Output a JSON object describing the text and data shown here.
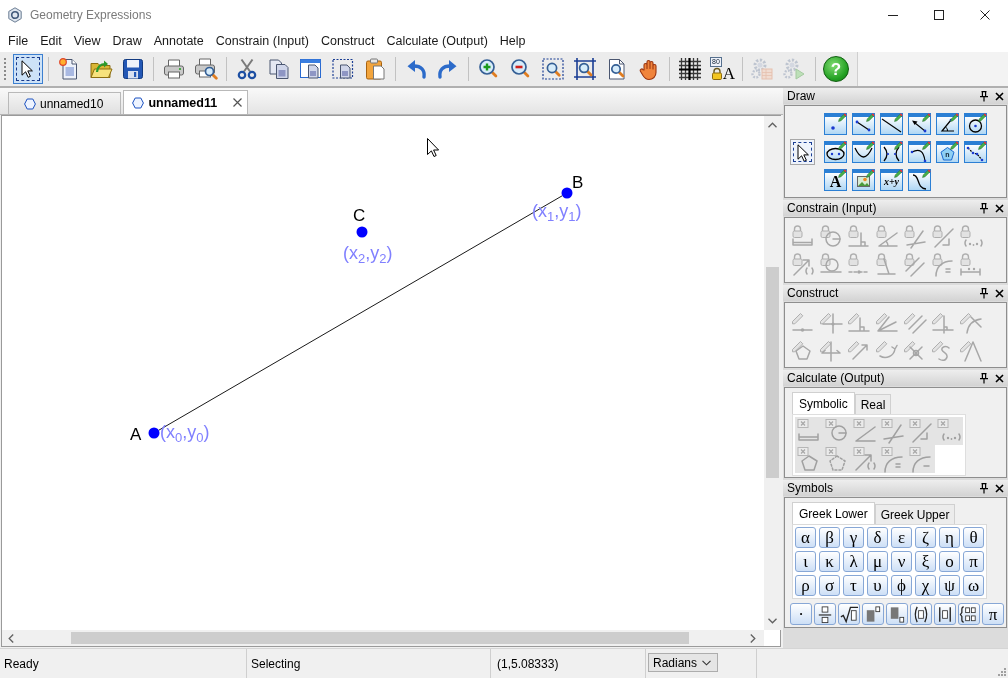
{
  "window": {
    "title": "Geometry Expressions"
  },
  "menu": [
    "File",
    "Edit",
    "View",
    "Draw",
    "Annotate",
    "Constrain (Input)",
    "Construct",
    "Calculate (Output)",
    "Help"
  ],
  "toolbar": {
    "groups": [
      [
        {
          "kind": "select",
          "selected": true,
          "disabled": false
        }
      ],
      [
        {
          "kind": "new",
          "selected": false,
          "disabled": false
        },
        {
          "kind": "open",
          "selected": false,
          "disabled": false
        },
        {
          "kind": "save",
          "selected": false,
          "disabled": false
        }
      ],
      [
        {
          "kind": "print",
          "selected": false,
          "disabled": false
        },
        {
          "kind": "print-preview",
          "selected": false,
          "disabled": false
        }
      ],
      [
        {
          "kind": "cut",
          "selected": false,
          "disabled": false
        },
        {
          "kind": "copy",
          "selected": false,
          "disabled": false
        },
        {
          "kind": "copy-window",
          "selected": false,
          "disabled": false
        },
        {
          "kind": "copy-region",
          "selected": false,
          "disabled": false
        },
        {
          "kind": "paste",
          "selected": false,
          "disabled": false
        }
      ],
      [
        {
          "kind": "undo",
          "selected": false,
          "disabled": false
        },
        {
          "kind": "redo",
          "selected": false,
          "disabled": false
        }
      ],
      [
        {
          "kind": "zoom-in",
          "selected": false,
          "disabled": false
        },
        {
          "kind": "zoom-out",
          "selected": false,
          "disabled": false
        },
        {
          "kind": "zoom-box",
          "selected": false,
          "disabled": false
        },
        {
          "kind": "zoom-fit",
          "selected": false,
          "disabled": false
        },
        {
          "kind": "zoom-page",
          "selected": false,
          "disabled": false
        },
        {
          "kind": "pan",
          "selected": false,
          "disabled": false
        }
      ],
      [
        {
          "kind": "grid",
          "selected": false,
          "disabled": false
        },
        {
          "kind": "lock-text",
          "badge": "80",
          "glyph": "A",
          "selected": false,
          "disabled": false
        }
      ],
      [
        {
          "kind": "gear-table",
          "selected": false,
          "disabled": true
        },
        {
          "kind": "gear-play",
          "selected": false,
          "disabled": true
        }
      ],
      [
        {
          "kind": "help",
          "glyph": "?",
          "selected": false,
          "disabled": false
        }
      ]
    ]
  },
  "document_tabs": [
    {
      "label": "unnamed10",
      "selected": false
    },
    {
      "label": "unnamed11",
      "selected": true
    }
  ],
  "canvas": {
    "segments": [
      {
        "points": [
          {
            "label": "A",
            "coordinates": "(x$_{0}$,y$_{0}$)"
          },
          {
            "label": "B",
            "coordinates": "(x$_{1}$,y$_{1}$)"
          }
        ]
      }
    ],
    "points": [
      {
        "label": "C",
        "coordinates": "(x$_{2}$,y$_{2}$)"
      }
    ]
  },
  "panels": {
    "draw": {
      "title": "Draw",
      "tools": [
        {
          "kind": "select",
          "selected": true
        },
        {
          "kind": "point",
          "selected": false
        },
        {
          "kind": "segment",
          "selected": false
        },
        {
          "kind": "line",
          "selected": false
        },
        {
          "kind": "vector",
          "selected": false
        },
        {
          "kind": "angle",
          "selected": false
        },
        {
          "kind": "circle",
          "selected": false
        },
        {
          "kind": "ellipse",
          "selected": false
        },
        {
          "kind": "parabola",
          "selected": false
        },
        {
          "kind": "hyperbola",
          "selected": false
        },
        {
          "kind": "arc",
          "selected": false
        },
        {
          "kind": "polygon",
          "glyph": "n",
          "selected": false
        },
        {
          "kind": "polyline",
          "selected": false
        },
        {
          "kind": "text",
          "glyph": "A",
          "selected": false
        },
        {
          "kind": "picture",
          "selected": false
        },
        {
          "kind": "expression",
          "glyph": "x+y",
          "selected": false
        },
        {
          "kind": "function",
          "selected": false
        }
      ]
    },
    "constrain": {
      "title": "Constrain (Input)",
      "disabled": true,
      "tools": [
        {
          "kind": "distance"
        },
        {
          "kind": "radius"
        },
        {
          "kind": "perpendicular"
        },
        {
          "kind": "angle"
        },
        {
          "kind": "crossing"
        },
        {
          "kind": "direction"
        },
        {
          "kind": "coordinates"
        },
        {
          "kind": "vector"
        },
        {
          "kind": "tangent-circle"
        },
        {
          "kind": "point-on-line"
        },
        {
          "kind": "incline"
        },
        {
          "kind": "parallel"
        },
        {
          "kind": "tangent-curve"
        },
        {
          "kind": "proportion"
        }
      ]
    },
    "construct": {
      "title": "Construct",
      "disabled": true,
      "tools": [
        {
          "kind": "midpoint"
        },
        {
          "kind": "intersection"
        },
        {
          "kind": "perpendicular"
        },
        {
          "kind": "bisector"
        },
        {
          "kind": "parallel"
        },
        {
          "kind": "perp-bisector"
        },
        {
          "kind": "tangent"
        },
        {
          "kind": "polygon"
        },
        {
          "kind": "reflection"
        },
        {
          "kind": "translation"
        },
        {
          "kind": "rotation"
        },
        {
          "kind": "dilation"
        },
        {
          "kind": "locus"
        },
        {
          "kind": "lines"
        }
      ]
    },
    "calculate": {
      "title": "Calculate (Output)",
      "tabs": [
        {
          "label": "Symbolic",
          "selected": true
        },
        {
          "label": "Real",
          "selected": false
        }
      ],
      "disabled": true,
      "tools": [
        {
          "kind": "distance"
        },
        {
          "kind": "circle"
        },
        {
          "kind": "angle"
        },
        {
          "kind": "crossing"
        },
        {
          "kind": "slope"
        },
        {
          "kind": "coordinates"
        },
        {
          "kind": "polygon"
        },
        {
          "kind": "dotted-polygon"
        },
        {
          "kind": "vector"
        },
        {
          "kind": "tangent"
        },
        {
          "kind": "curve"
        }
      ]
    },
    "symbols": {
      "title": "Symbols",
      "tabs": [
        {
          "label": "Greek Lower",
          "selected": true
        },
        {
          "label": "Greek Upper",
          "selected": false
        }
      ],
      "letters": [
        "α",
        "β",
        "γ",
        "δ",
        "ε",
        "ζ",
        "η",
        "θ",
        "ι",
        "κ",
        "λ",
        "μ",
        "ν",
        "ξ",
        "ο",
        "π",
        "ρ",
        "σ",
        "τ",
        "υ",
        "ϕ",
        "χ",
        "ψ",
        "ω"
      ],
      "templates": [
        {
          "kind": "text",
          "label": "·"
        },
        {
          "kind": "fraction"
        },
        {
          "kind": "sqrt"
        },
        {
          "kind": "superscript"
        },
        {
          "kind": "subscript"
        },
        {
          "kind": "parentheses"
        },
        {
          "kind": "absolute"
        },
        {
          "kind": "matrix"
        },
        {
          "kind": "text",
          "label": "π"
        }
      ]
    }
  },
  "status_bar": {
    "fields": [
      "Ready",
      "Selecting",
      "(1,5.08333)"
    ],
    "angle_unit": "Radians"
  }
}
